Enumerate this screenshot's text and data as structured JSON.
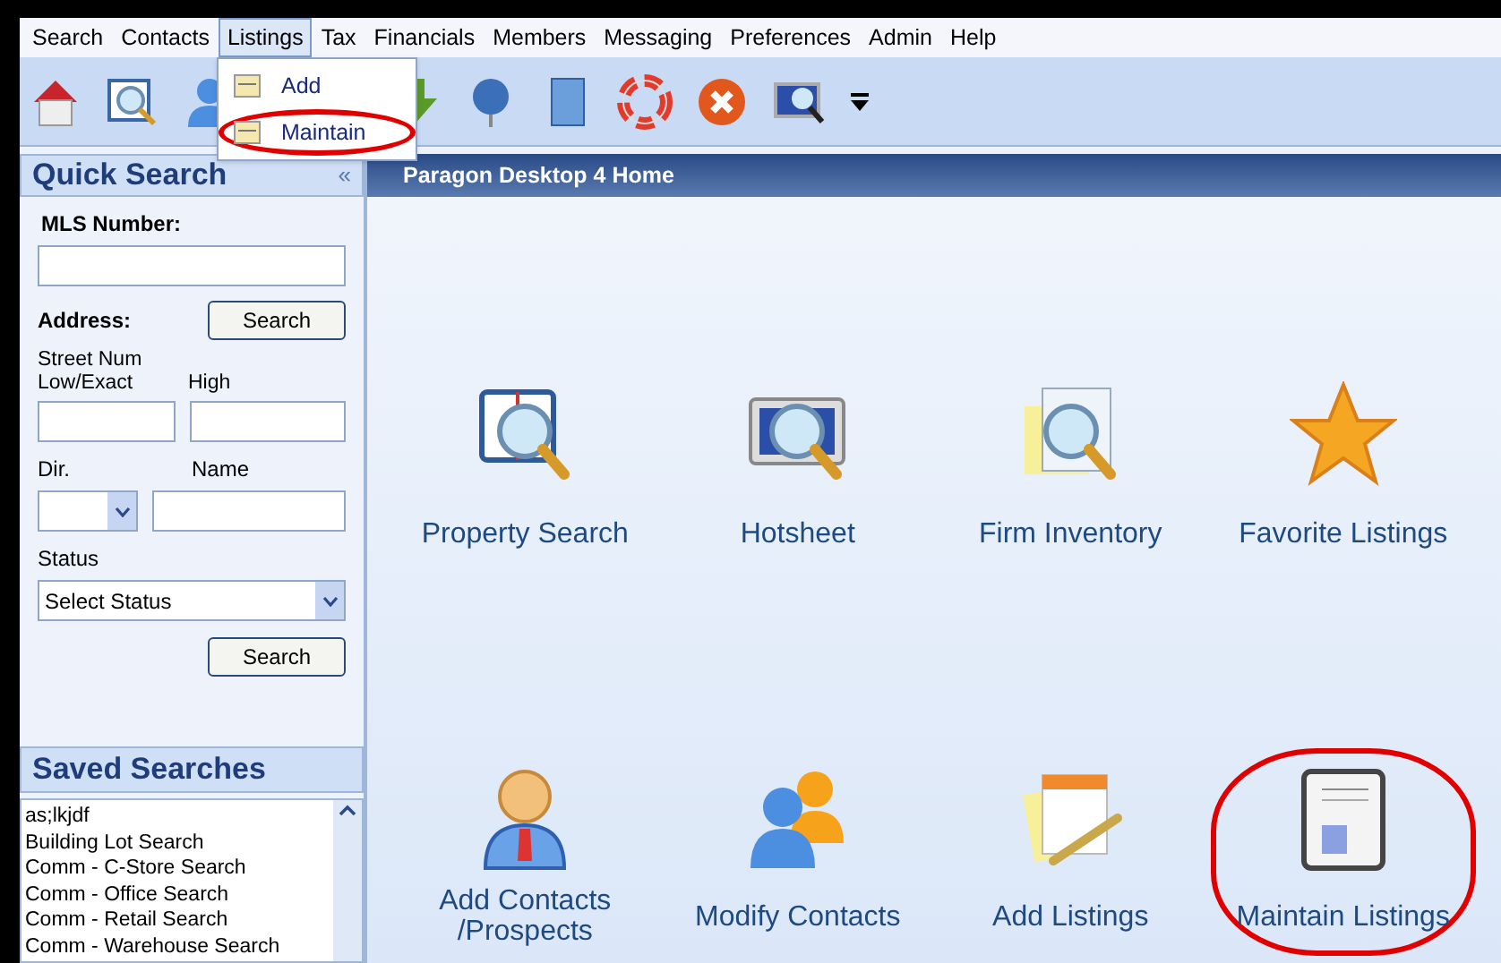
{
  "menu_bar": [
    {
      "label": "Search",
      "selected": false
    },
    {
      "label": "Contacts",
      "selected": false
    },
    {
      "label": "Listings",
      "selected": true
    },
    {
      "label": "Tax",
      "selected": false
    },
    {
      "label": "Financials",
      "selected": false
    },
    {
      "label": "Members",
      "selected": false
    },
    {
      "label": "Messaging",
      "selected": false
    },
    {
      "label": "Preferences",
      "selected": false
    },
    {
      "label": "Admin",
      "selected": false
    },
    {
      "label": "Help",
      "selected": false
    }
  ],
  "listings_menu": [
    {
      "label": "Add",
      "circled": false
    },
    {
      "label": "Maintain",
      "circled": true
    }
  ],
  "quick_search": {
    "title": "Quick Search",
    "collapse": "«",
    "mls_label": "MLS Number:",
    "address_label": "Address:",
    "address_button": "Search",
    "street_low_label": "Street Num Low/Exact",
    "street_high_label": "High",
    "dir_label": "Dir.",
    "name_label": "Name",
    "status_label": "Status",
    "status_value": "Select Status",
    "search_button": "Search"
  },
  "saved_searches": {
    "title": "Saved Searches",
    "items": [
      "as;lkjdf",
      "Building Lot Search",
      "Comm - C-Store Search",
      "Comm - Office Search",
      "Comm - Retail Search",
      "Comm - Warehouse Search"
    ]
  },
  "main": {
    "title": "Paragon Desktop 4 Home",
    "tiles": [
      {
        "kind": "property-search",
        "label": "Property Search",
        "circled": false
      },
      {
        "kind": "hotsheet",
        "label": "Hotsheet",
        "circled": false
      },
      {
        "kind": "firm-inventory",
        "label": "Firm Inventory",
        "circled": false
      },
      {
        "kind": "favorite",
        "label": "Favorite Listings",
        "circled": false
      },
      {
        "kind": "add-contacts",
        "label": "Add Contacts /Prospects",
        "circled": false
      },
      {
        "kind": "modify-contacts",
        "label": "Modify Contacts",
        "circled": false
      },
      {
        "kind": "add-listings",
        "label": "Add Listings",
        "circled": false
      },
      {
        "kind": "maintain-listings",
        "label": "Maintain Listings",
        "circled": true
      }
    ]
  }
}
